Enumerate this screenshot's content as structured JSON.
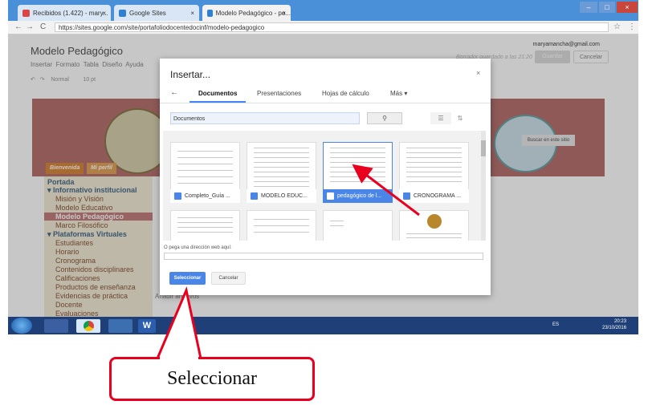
{
  "browser": {
    "tabs": [
      {
        "label": "Recibidos (1.422) - mary..."
      },
      {
        "label": "Google Sites"
      },
      {
        "label": "Modelo Pedagógico - po..."
      }
    ],
    "url": "https://sites.google.com/site/portafoliodocentedocinf/modelo-pedagogico"
  },
  "editor": {
    "site_title": "Modelo Pedagógico",
    "menu": [
      "Insertar",
      "Formato",
      "Tabla",
      "Diseño",
      "Ayuda"
    ],
    "toolbar_text": "Normal",
    "font_size": "10 pt",
    "account": "maryamancha@gmail.com",
    "saved_note": "Borrador guardado a las 21:20",
    "save_label": "Guardar",
    "cancel_label": "Cancelar",
    "search_site": "Buscar en este sitio",
    "page_tabs": [
      "Bienvenida",
      "Mi perfil"
    ],
    "sidebar": [
      {
        "label": "Portada",
        "type": "h"
      },
      {
        "label": "▾ Informativo institucional",
        "type": "h"
      },
      {
        "label": "Misión y Visión",
        "type": "s"
      },
      {
        "label": "Modelo Educativo",
        "type": "s"
      },
      {
        "label": "Modelo Pedagógico",
        "type": "sel"
      },
      {
        "label": "Marco Filosófico",
        "type": "s"
      },
      {
        "label": "▾ Plataformas Virtuales",
        "type": "h"
      },
      {
        "label": "Estudiantes",
        "type": "s"
      },
      {
        "label": "Horario",
        "type": "s"
      },
      {
        "label": "Cronograma",
        "type": "s"
      },
      {
        "label": "Contenidos disciplinares",
        "type": "s"
      },
      {
        "label": "Calificaciones",
        "type": "s"
      },
      {
        "label": "Productos de enseñanza",
        "type": "s"
      },
      {
        "label": "Evidencias de práctica",
        "type": "s"
      },
      {
        "label": "Docente",
        "type": "s"
      },
      {
        "label": "Evaluaciones",
        "type": "s"
      }
    ],
    "attachments": "Añadir archivos"
  },
  "modal": {
    "title": "Insertar...",
    "close": "×",
    "back": "←",
    "tabs": [
      "Documentos",
      "Presentaciones",
      "Hojas de cálculo",
      "Más ▾"
    ],
    "search_value": "Documentos",
    "search_icon": "🔍",
    "view_icon": "list-view-icon",
    "sort_icon": "sort-icon",
    "files": [
      {
        "name": "Completo_Guía ...",
        "selected": false
      },
      {
        "name": "MODELO EDUC...",
        "selected": false
      },
      {
        "name": "pedagógico de l...",
        "selected": true
      },
      {
        "name": "CRONOGRAMA ...",
        "selected": false
      }
    ],
    "url_label": "O pega una dirección web aquí:",
    "select_label": "Seleccionar",
    "cancel_label": "Cancelar"
  },
  "taskbar": {
    "lang": "ES",
    "time": "20:23",
    "date": "23/10/2016"
  },
  "callout": {
    "text": "Seleccionar"
  },
  "colors": {
    "accent": "#4a86e8",
    "banner": "#b67270",
    "callout_border": "#e8001e",
    "arrow": "#e8001e"
  }
}
